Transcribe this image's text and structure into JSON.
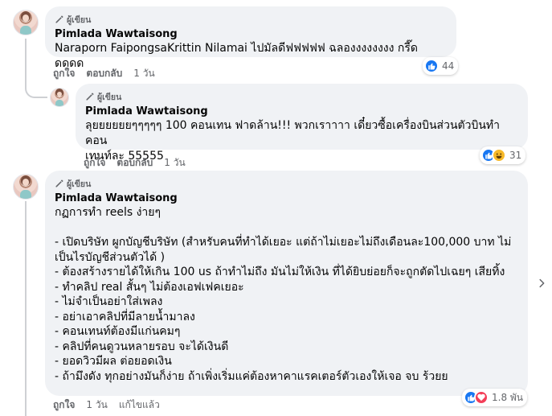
{
  "author_badge": "ผู้เขียน",
  "comments": [
    {
      "author": "Pimlada Wawtaisong",
      "text": "Naraporn FaipongsaKrittin Nilamai ไปมัลดีฟฟฟฟฟ ฉลองงงงงงงง กรี๊ดดดดด",
      "like_label": "ถูกใจ",
      "reply_label": "ตอบกลับ",
      "time": "1 วัน",
      "reaction_count": "44"
    },
    {
      "author": "Pimlada Wawtaisong",
      "text": "ลุยยยยยยๆๆๆๆๆ 100 คอนเทน ฟาดล้าน!!! พวกเราาาา เดี๋ยวซื้อเครื่องบินส่วนตัวบินทำคอน\nเทนท์ละ 55555",
      "like_label": "ถูกใจ",
      "reply_label": "ตอบกลับ",
      "time": "1 วัน",
      "reaction_count": "31"
    },
    {
      "author": "Pimlada Wawtaisong",
      "text": "กฏการทำ reels ง่ายๆ\n\n- เปิดบริษัท ผูกบัญชีบริษัท (สำหรับคนที่ทำได้เยอะ แต่ถ้าไม่เยอะไม่ถึงเดือนละ100,000 บาท ไม่\nเป็นไรบัญชีส่วนตัวได้ )\n- ต้องสร้างรายได้ให้เกิน 100 us ถ้าทำไม่ถึง มันไม่ให้เงิน ที่ได้ยิบย่อยก็จะถูกตัดไปเฉยๆ เสียทิ้ง\n- ทำคลิป real สั้นๆ ไม่ต้องเอฟเฟคเยอะ\n- ไม่จำเป็นอย่าใส่เพลง\n- อย่าเอาคลิปที่มีลายน้ำมาลง\n- คอนเทนท์ต้องมีแก่นคมๆ\n- คลิปที่คนดูวนหลายรอบ จะได้เงินดี\n- ยอดวิวมีผล ต่อยอดเงิน\n- ถ้ามึงดัง ทุกอย่างมันก็ง่าย ถ้าเพิ่งเริ่มแค่ต้องหาคาแรคเตอร์ตัวเองให้เจอ จบ ร้วยย",
      "like_label": "ถูกใจ",
      "time": "1 วัน",
      "edited_label": "แก้ไขแล้ว",
      "reaction_count": "1.8 พัน"
    }
  ],
  "colors": {
    "bubble": "#f0f2f5",
    "secondary_text": "#65676b",
    "like_blue": "#1877f2",
    "haha_yellow": "#f7b928",
    "love_red": "#f33e58"
  }
}
